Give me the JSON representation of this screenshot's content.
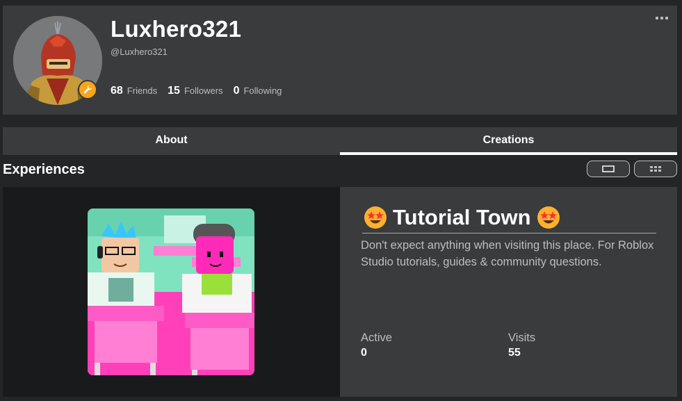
{
  "profile": {
    "display_name": "Luxhero321",
    "username": "@Luxhero321",
    "stats": [
      {
        "value": "68",
        "label": "Friends"
      },
      {
        "value": "15",
        "label": "Followers"
      },
      {
        "value": "0",
        "label": "Following"
      }
    ],
    "avatar_icon": "knight-avatar",
    "badge_icon": "wrench-icon"
  },
  "tabs": [
    {
      "label": "About",
      "active": false
    },
    {
      "label": "Creations",
      "active": true
    }
  ],
  "section": {
    "title": "Experiences"
  },
  "experience": {
    "title": "Tutorial Town",
    "title_emoji": "star-struck-emoji",
    "description": "Don't expect anything when visiting this place. For Roblox Studio tutorials, guides & community questions.",
    "active_label": "Active",
    "active_value": "0",
    "visits_label": "Visits",
    "visits_value": "55"
  },
  "colors": {
    "page_bg": "#232527",
    "panel_bg": "#393b3d",
    "thumb_panel_bg": "#191a1c",
    "muted_text": "#bdbebe",
    "badge": "#f7a51c"
  }
}
